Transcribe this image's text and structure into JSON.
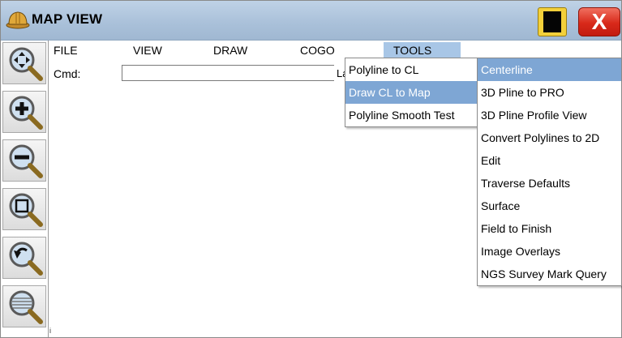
{
  "window": {
    "title": "MAP VIEW",
    "app_icon": "hard-hat-icon",
    "keyboard_icon": "keyboard-icon",
    "close_icon": "close-x-icon",
    "close_label": "X"
  },
  "menu_bar": {
    "items": [
      {
        "label": "FILE"
      },
      {
        "label": "VIEW"
      },
      {
        "label": "DRAW"
      },
      {
        "label": "COGO"
      },
      {
        "label": "TOOLS"
      }
    ],
    "active": "TOOLS"
  },
  "command": {
    "label": "Cmd:",
    "value": "",
    "trailing_text": "La"
  },
  "left_toolbar": {
    "buttons": [
      {
        "icon": "pan-icon"
      },
      {
        "icon": "zoom-in-icon"
      },
      {
        "icon": "zoom-out-icon"
      },
      {
        "icon": "zoom-window-icon"
      },
      {
        "icon": "zoom-previous-icon"
      },
      {
        "icon": "zoom-extents-icon"
      }
    ]
  },
  "corner_mark": "i",
  "tools_menu": {
    "items": [
      {
        "label": "Polyline to CL",
        "highlighted": false
      },
      {
        "label": "Draw CL to Map",
        "highlighted": true
      },
      {
        "label": "Polyline Smooth Test",
        "highlighted": false
      }
    ]
  },
  "submenu": {
    "items": [
      {
        "label": "Centerline",
        "highlighted": true
      },
      {
        "label": "3D Pline to PRO",
        "highlighted": false
      },
      {
        "label": "3D Pline Profile View",
        "highlighted": false
      },
      {
        "label": "Convert Polylines to 2D",
        "highlighted": false
      },
      {
        "label": "Edit",
        "highlighted": false
      },
      {
        "label": "Traverse Defaults",
        "highlighted": false
      },
      {
        "label": "Surface",
        "highlighted": false
      },
      {
        "label": "Field to Finish",
        "highlighted": false
      },
      {
        "label": "Image Overlays",
        "highlighted": false
      },
      {
        "label": "NGS Survey Mark Query",
        "highlighted": false
      }
    ]
  },
  "colors": {
    "titlebar": "#a9c0d9",
    "menu_highlight": "#7ea6d4",
    "tools_highlight": "#a8c6e6",
    "close_button": "#d8291a",
    "keyboard_button": "#f3d03a"
  }
}
